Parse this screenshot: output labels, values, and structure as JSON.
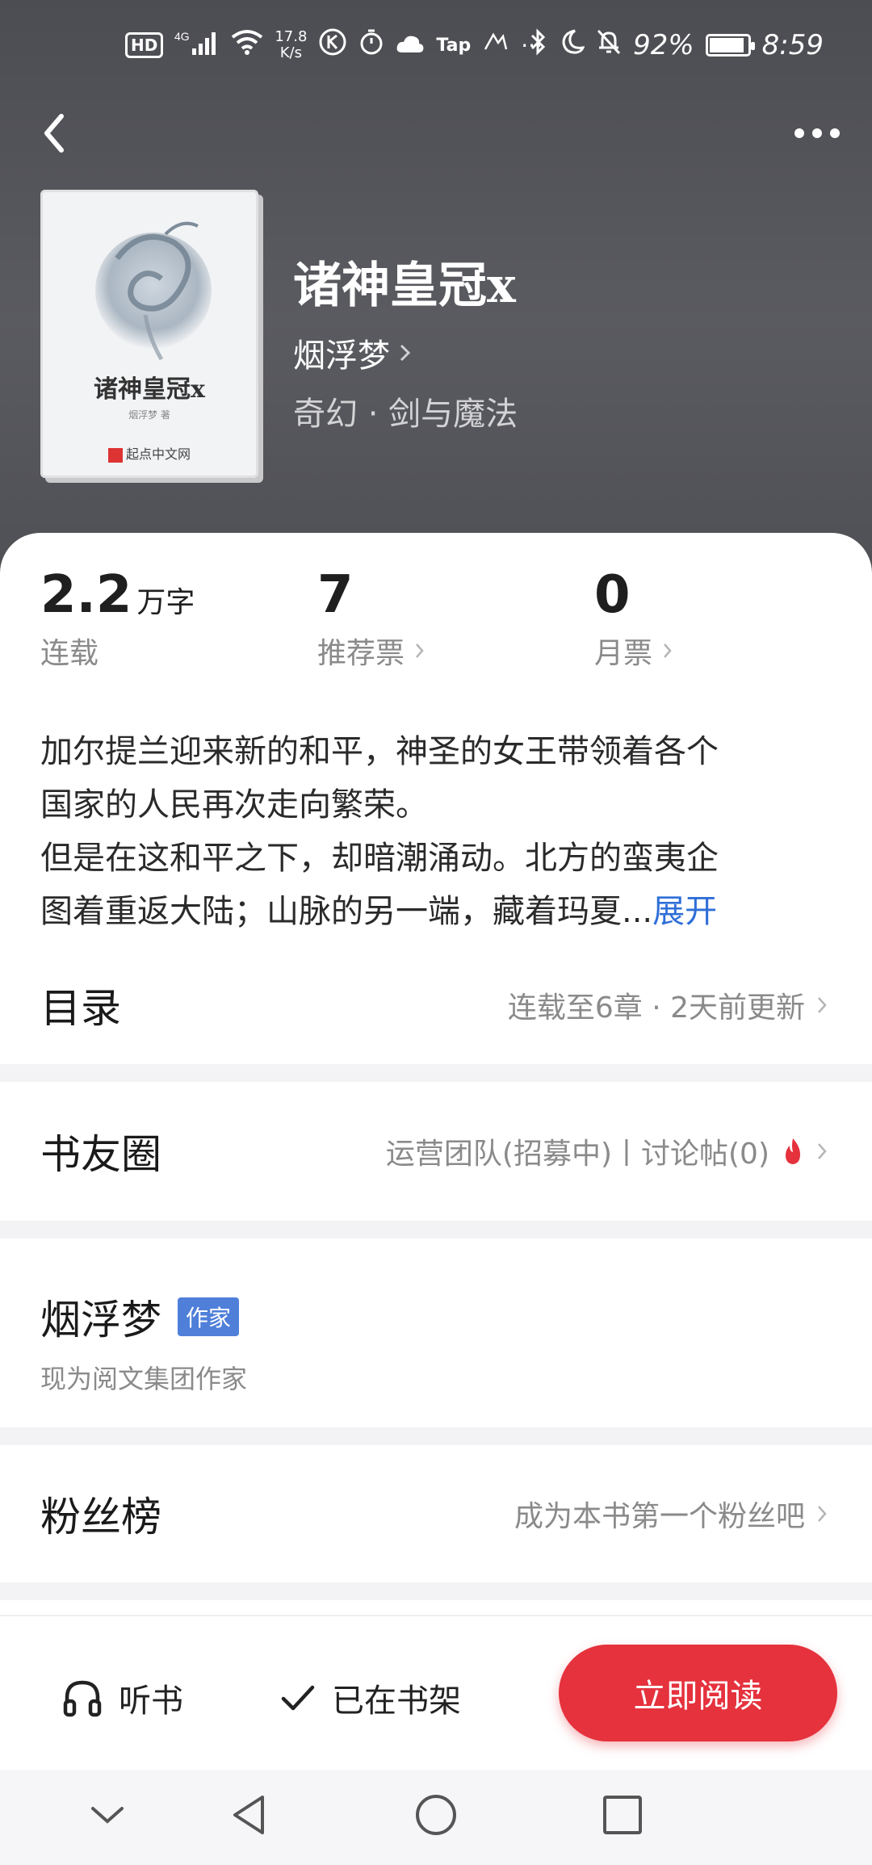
{
  "status_bar": {
    "hd": "HD",
    "signal": "4G",
    "net_speed_value": "17.8",
    "net_speed_unit": "K/s",
    "app_badge": "Tap",
    "more": "···",
    "battery_percent": "92%",
    "battery_level": 0.92,
    "time": "8:59"
  },
  "book": {
    "title": "诸神皇冠x",
    "author": "烟浮梦",
    "genre": "奇幻 · 剑与魔法",
    "cover": {
      "title": "诸神皇冠x",
      "author": "烟浮梦 著",
      "publisher": "起点中文网"
    }
  },
  "stats": [
    {
      "value": "2.2",
      "unit": "万字",
      "label": "连载",
      "has_chevron": false
    },
    {
      "value": "7",
      "unit": "",
      "label": "推荐票",
      "has_chevron": true
    },
    {
      "value": "0",
      "unit": "",
      "label": "月票",
      "has_chevron": true
    }
  ],
  "description": {
    "lines": [
      "加尔提兰迎来新的和平，神圣的女王带领着各个",
      "国家的人民再次走向繁荣。",
      "但是在这和平之下，却暗潮涌动。北方的蛮夷企",
      "图着重返大陆；山脉的另一端，藏着玛夏..."
    ],
    "expand_label": "展开"
  },
  "toc": {
    "title": "目录",
    "info": "连载至6章 · 2天前更新"
  },
  "community": {
    "title": "书友圈",
    "info": "运营团队(招募中)丨讨论帖(0)"
  },
  "author_section": {
    "name": "烟浮梦",
    "badge": "作家",
    "subtitle": "现为阅文集团作家"
  },
  "fans": {
    "title": "粉丝榜",
    "info": "成为本书第一个粉丝吧"
  },
  "actions": {
    "listen": "听书",
    "shelf": "已在书架",
    "read": "立即阅读"
  },
  "colors": {
    "accent_red": "#e5323d",
    "link_blue": "#2f6fd8",
    "badge_blue": "#4f7fd9",
    "header_bg": "#55565b"
  },
  "icons": {
    "back": "back-arrow-icon",
    "more": "more-dots-icon",
    "listen": "headphones-icon",
    "shelf": "checkmark-icon",
    "hot": "flame-icon",
    "nav_collapse": "chevron-down-icon",
    "nav_back": "triangle-back-icon",
    "nav_home": "circle-home-icon",
    "nav_recents": "square-recents-icon"
  }
}
